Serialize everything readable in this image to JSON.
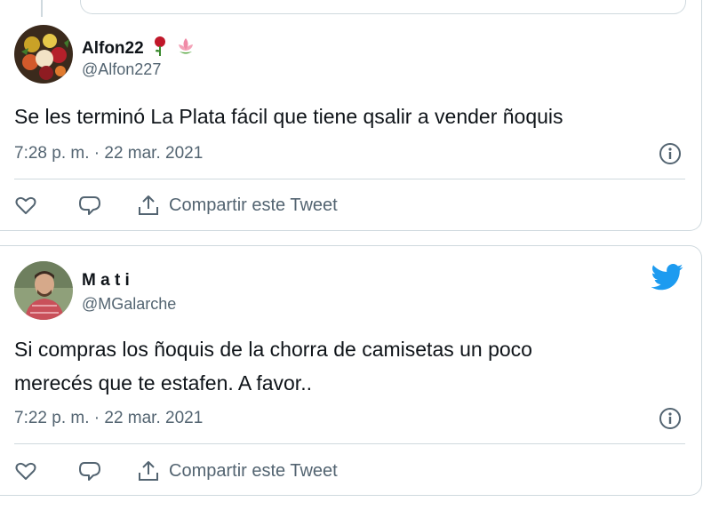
{
  "tweets": [
    {
      "name": "Alfon22",
      "name_emojis": [
        "rose-emoji",
        "lotus-emoji"
      ],
      "handle": "@Alfon227",
      "text": "Se les terminó La Plata fácil que tiene qsalir a vender ñoquis",
      "timestamp": "7:28 p. m. · 22 mar. 2021",
      "share_label": "Compartir este Tweet"
    },
    {
      "name": "M a t i",
      "handle": "@MGalarche",
      "text_lines": [
        "Si compras los ñoquis de la chorra de camisetas un poco",
        "merecés que te estafen. A favor.."
      ],
      "timestamp": "7:22 p. m. · 22 mar. 2021",
      "share_label": "Compartir este Tweet"
    }
  ],
  "colors": {
    "text": "#0f1419",
    "secondary": "#536471",
    "border": "#cfd9de",
    "twitter_blue": "#1d9bf0"
  },
  "icons": [
    "heart-icon",
    "reply-icon",
    "share-icon",
    "info-icon",
    "twitter-logo-icon"
  ]
}
